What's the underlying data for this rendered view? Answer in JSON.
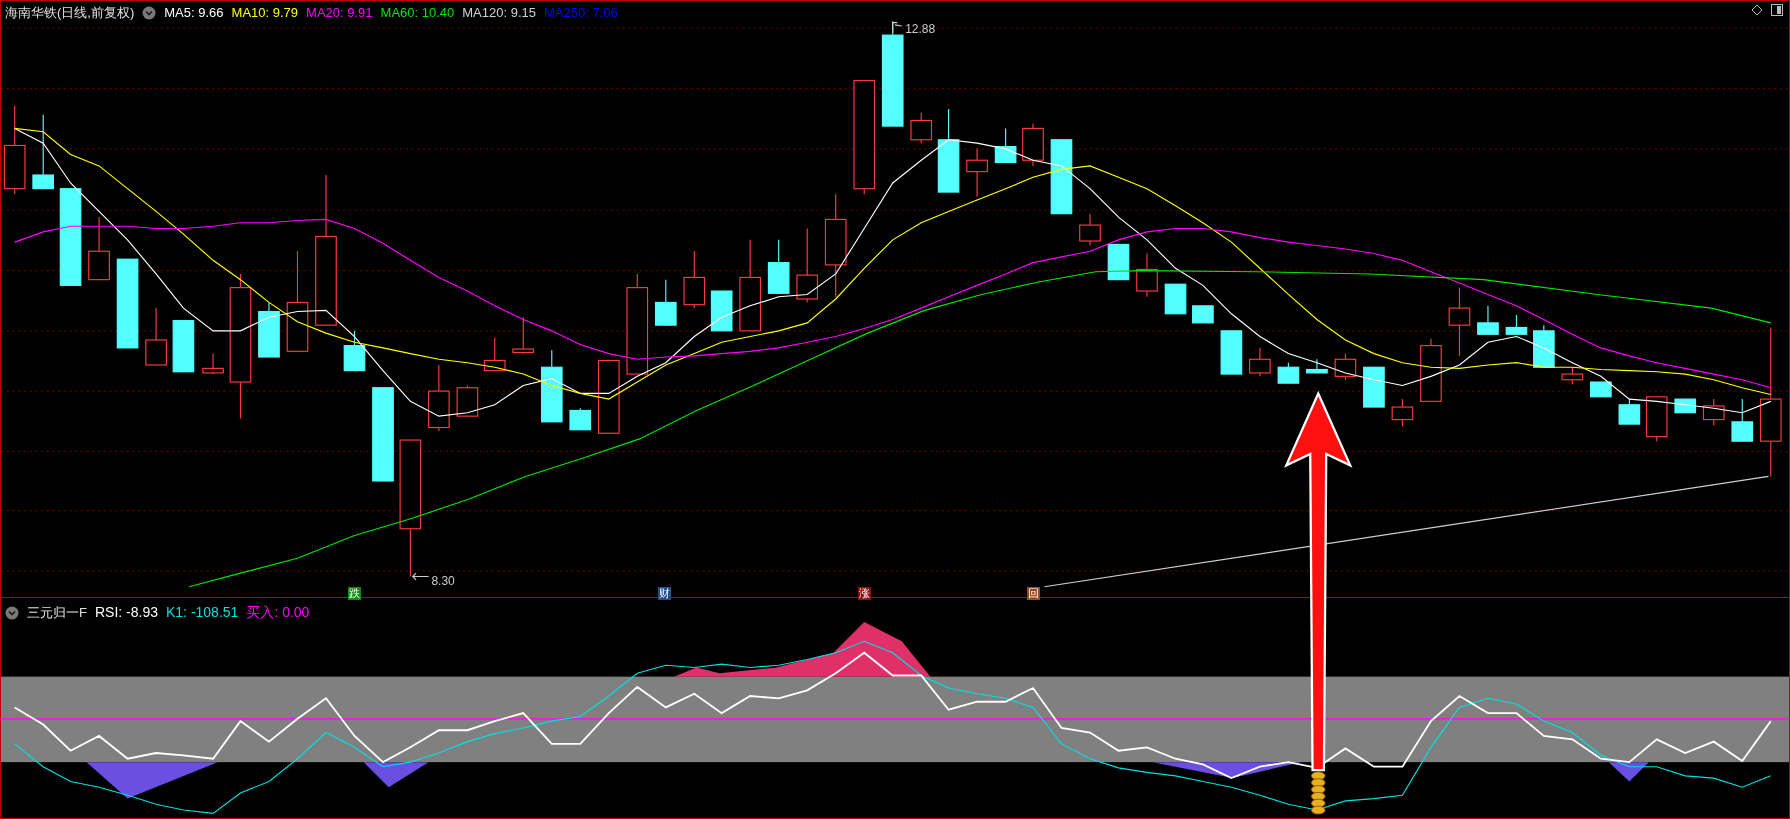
{
  "stock_header": {
    "title": "海南华铁(日线,前复权)",
    "indicators": [
      {
        "label": "MA5: 9.66",
        "color": "#ffffff"
      },
      {
        "label": "MA10: 9.79",
        "color": "#ffff00"
      },
      {
        "label": "MA20: 9.91",
        "color": "#ff00ff"
      },
      {
        "label": "MA60: 10.40",
        "color": "#00e600"
      },
      {
        "label": "MA120: 9.15",
        "color": "#d0d0d0"
      },
      {
        "label": "MA250: 7.06",
        "color": "#0000ff"
      }
    ]
  },
  "price_marks": {
    "high": "12.88",
    "low": "8.30"
  },
  "event_markers": [
    {
      "label": "跌",
      "color": "#138a13"
    },
    {
      "label": "财",
      "color": "#1d4f8f"
    },
    {
      "label": "涨",
      "color": "#8c1010"
    },
    {
      "label": "回",
      "color": "#9a4a18"
    }
  ],
  "indicator_panel": {
    "title": "三元归一F",
    "values": [
      {
        "label": "RSI: -8.93",
        "color": "#ffffff"
      },
      {
        "label": "K1: -108.51",
        "color": "#00e0e0"
      },
      {
        "label": "买入: 0.00",
        "color": "#ff00ff"
      }
    ]
  }
}
